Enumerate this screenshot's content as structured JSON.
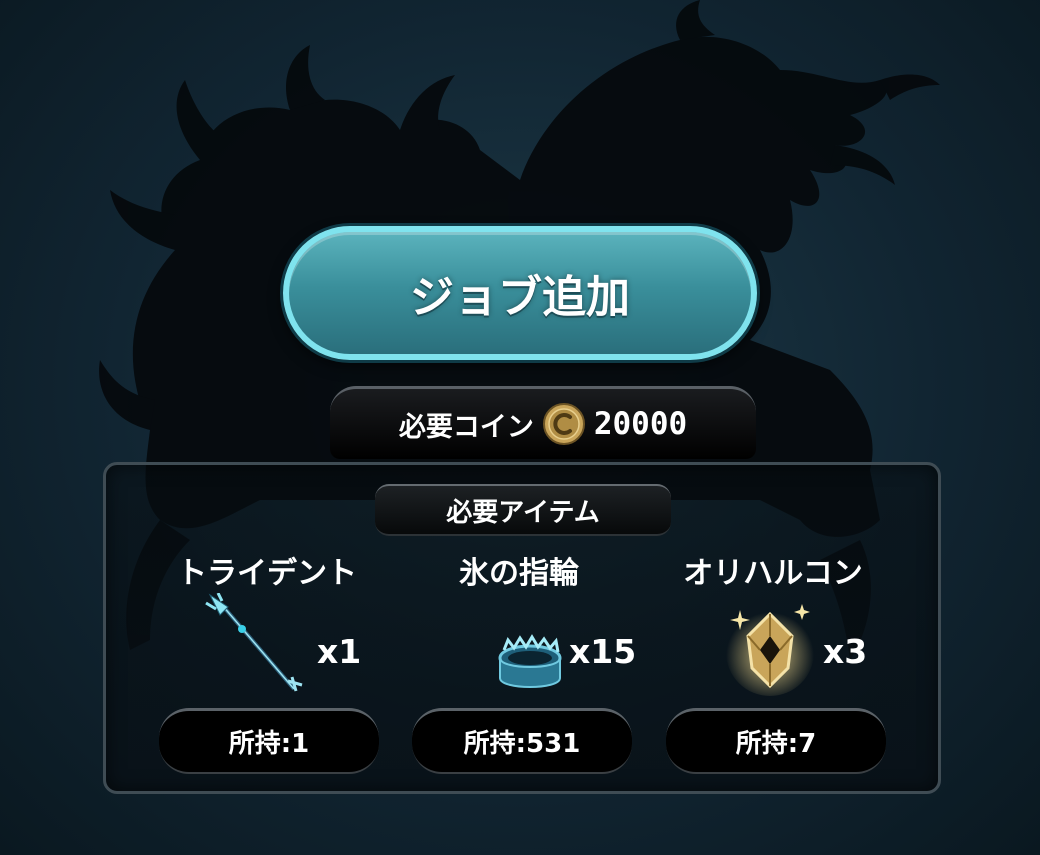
{
  "job_button": {
    "label": "ジョブ追加"
  },
  "required_coins": {
    "label": "必要コイン",
    "icon": "coin-c-icon",
    "amount": "20000"
  },
  "required_items": {
    "title": "必要アイテム",
    "items": [
      {
        "name": "トライデント",
        "icon": "trident-icon",
        "qty": "x1",
        "owned": "所持:1"
      },
      {
        "name": "氷の指輪",
        "icon": "ice-ring-icon",
        "qty": "x15",
        "owned": "所持:531"
      },
      {
        "name": "オリハルコン",
        "icon": "orichalcum-crystal-icon",
        "qty": "x3",
        "owned": "所持:7"
      }
    ]
  },
  "colors": {
    "button_teal": "#3a8f9b",
    "button_rim": "#7fe3ee",
    "background": "#112532",
    "coin_gold": "#c9a55a"
  }
}
